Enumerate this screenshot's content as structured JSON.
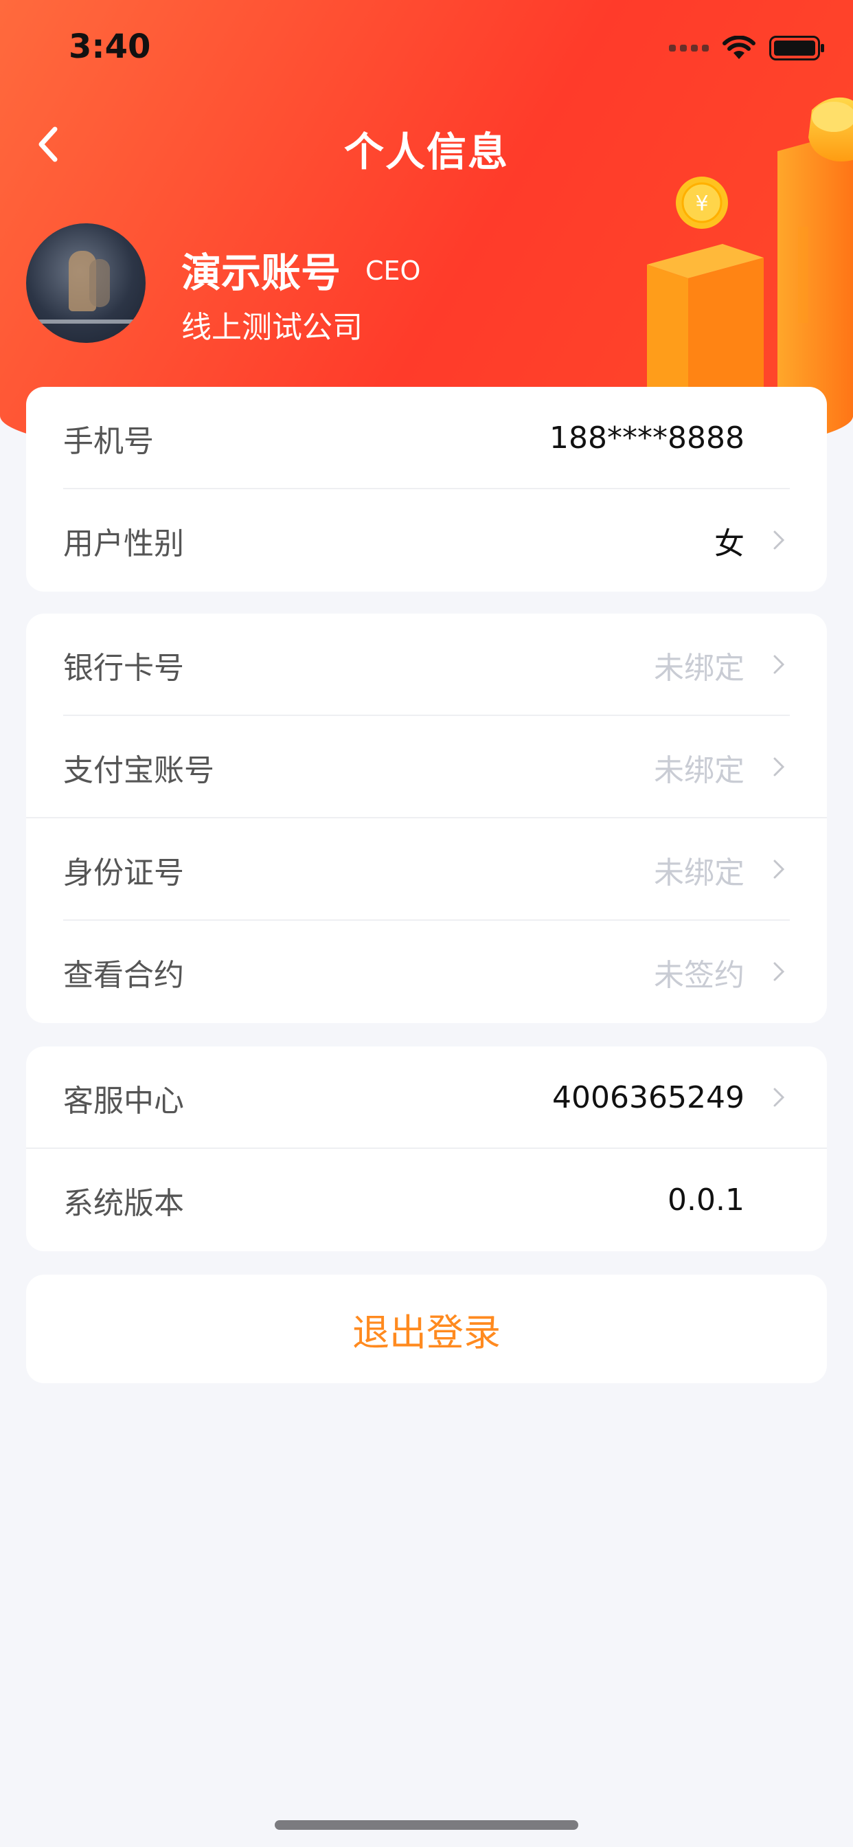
{
  "status_bar": {
    "time": "3:40"
  },
  "nav": {
    "title": "个人信息"
  },
  "profile": {
    "name": "演示账号",
    "role": "CEO",
    "company": "线上测试公司"
  },
  "card1": {
    "phone": {
      "label": "手机号",
      "value": "188****8888"
    },
    "gender": {
      "label": "用户性别",
      "value": "女"
    }
  },
  "card2": {
    "bank": {
      "label": "银行卡号",
      "value": "未绑定"
    },
    "alipay": {
      "label": "支付宝账号",
      "value": "未绑定"
    },
    "idcard": {
      "label": "身份证号",
      "value": "未绑定"
    },
    "contract": {
      "label": "查看合约",
      "value": "未签约"
    }
  },
  "card3": {
    "service": {
      "label": "客服中心",
      "value": "4006365249"
    },
    "version": {
      "label": "系统版本",
      "value": "0.0.1"
    }
  },
  "logout_label": "退出登录",
  "colors": {
    "header": "#ff4a2a",
    "accent": "#ff8a1f",
    "muted": "#c9ccd4"
  }
}
